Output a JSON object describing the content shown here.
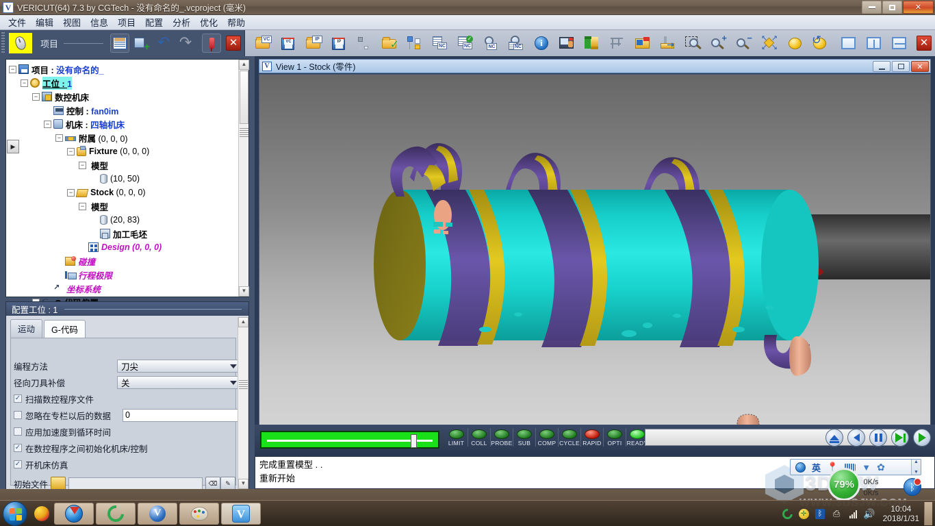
{
  "window": {
    "title": "VERICUT(64)  7.3 by CGTech - 没有命名的_.vcproject (毫米)",
    "icon": "vericut-icon",
    "buttons": {
      "minimize": "minimize-button",
      "restore": "restore-button",
      "close": "✕"
    }
  },
  "menubar": {
    "items": [
      "文件",
      "编辑",
      "视图",
      "信息",
      "项目",
      "配置",
      "分析",
      "优化",
      "帮助"
    ]
  },
  "toolbar_left": {
    "label": "项目",
    "buttons": [
      {
        "name": "mouse-config-icon",
        "glyph": "mouse"
      },
      {
        "name": "project-tree-button",
        "glyph": "project"
      },
      {
        "name": "add-component-button",
        "glyph": "add"
      },
      {
        "name": "undo-button",
        "glyph": "↶"
      },
      {
        "name": "redo-button",
        "glyph": "↷"
      },
      {
        "name": "pin-button",
        "glyph": "pin"
      },
      {
        "name": "close-panel-button",
        "glyph": "✕"
      }
    ]
  },
  "toolbar_main": {
    "buttons": [
      {
        "name": "open-project-icon",
        "label": "VC"
      },
      {
        "name": "save-project-icon",
        "label": "VC"
      },
      {
        "name": "open-inprocess-icon",
        "label": "IP"
      },
      {
        "name": "save-inprocess-icon",
        "label": "IP"
      },
      {
        "name": "tool-manager-icon",
        "label": ""
      },
      {
        "name": "open-verified-icon",
        "label": ""
      },
      {
        "name": "model-export-icon",
        "label": ""
      },
      {
        "name": "nc-program-icon",
        "label": "NC"
      },
      {
        "name": "nc-program-verified-icon",
        "label": "NC"
      },
      {
        "name": "nc-program-review-icon",
        "label": "NC"
      },
      {
        "name": "nc-review-list-icon",
        "label": "NC"
      },
      {
        "name": "info-icon",
        "label": "i"
      },
      {
        "name": "machine-control-icon",
        "label": ""
      },
      {
        "name": "autodiff-icon",
        "label": ""
      },
      {
        "name": "caliper-measure-icon",
        "label": ""
      },
      {
        "name": "notes-icon",
        "label": ""
      },
      {
        "name": "cut-stock-icon",
        "label": ""
      },
      {
        "name": "zoom-box-icon",
        "label": ""
      },
      {
        "name": "zoom-in-icon",
        "label": "+"
      },
      {
        "name": "zoom-out-icon",
        "label": "−"
      },
      {
        "name": "fit-view-icon",
        "label": ""
      },
      {
        "name": "rotate-sphere-icon",
        "label": ""
      },
      {
        "name": "reset-rotation-icon",
        "label": ""
      },
      {
        "name": "single-pane-icon",
        "label": ""
      },
      {
        "name": "two-pane-vertical-icon",
        "label": ""
      },
      {
        "name": "two-pane-horizontal-icon",
        "label": ""
      },
      {
        "name": "close-view-icon",
        "label": "✕"
      }
    ]
  },
  "tree": {
    "expander_glyph": "▶",
    "nodes": [
      {
        "indent": 0,
        "exp": "−",
        "icon": "save-icon",
        "label": "项目 : ",
        "value": "没有命名的_",
        "style": "blue"
      },
      {
        "indent": 1,
        "exp": "−",
        "icon": "gear-icon",
        "label": "工位 : ",
        "value": "1",
        "style": "selected"
      },
      {
        "indent": 2,
        "exp": "−",
        "icon": "machine-icon",
        "label": "数控机床",
        "value": "",
        "style": "bold"
      },
      {
        "indent": 3,
        "exp": "",
        "icon": "control-icon",
        "label": "控制 : ",
        "value": "fan0im",
        "style": "blue"
      },
      {
        "indent": 3,
        "exp": "−",
        "icon": "tool-icon",
        "label": "机床 : ",
        "value": "四轴机床",
        "style": "blue"
      },
      {
        "indent": 4,
        "exp": "−",
        "icon": "attach-icon",
        "label": "附属 ",
        "value": "(0, 0, 0)",
        "style": "plain"
      },
      {
        "indent": 5,
        "exp": "−",
        "icon": "fixture-icon",
        "label": "Fixture ",
        "value": "(0, 0, 0)",
        "style": "plain"
      },
      {
        "indent": 6,
        "exp": "−",
        "icon": "model-icon",
        "label": "模型",
        "value": "",
        "style": "bold"
      },
      {
        "indent": 7,
        "exp": "",
        "icon": "cylinder-icon",
        "label": "",
        "value": "(10, 50)",
        "style": "plain"
      },
      {
        "indent": 5,
        "exp": "−",
        "icon": "stock-icon",
        "label": "Stock ",
        "value": "(0, 0, 0)",
        "style": "plain"
      },
      {
        "indent": 6,
        "exp": "−",
        "icon": "model-icon",
        "label": "模型",
        "value": "",
        "style": "bold"
      },
      {
        "indent": 7,
        "exp": "",
        "icon": "cylinder-icon",
        "label": "",
        "value": "(20, 83)",
        "style": "plain"
      },
      {
        "indent": 7,
        "exp": "",
        "icon": "blank-icon",
        "label": "加工毛坯",
        "value": "",
        "style": "bold"
      },
      {
        "indent": 6,
        "exp": "",
        "icon": "design-icon",
        "label": "Design ",
        "value": "(0, 0, 0)",
        "style": "magenta"
      },
      {
        "indent": 4,
        "exp": "",
        "icon": "collision-icon",
        "label": "碰撞",
        "value": "",
        "style": "magenta"
      },
      {
        "indent": 4,
        "exp": "",
        "icon": "travel-limit-icon",
        "label": "行程极限",
        "value": "",
        "style": "magenta"
      },
      {
        "indent": 3,
        "exp": "",
        "icon": "coord-system-icon",
        "label": "坐标系统",
        "value": "",
        "style": "magenta"
      },
      {
        "indent": 2,
        "exp": "−",
        "icon": "gcode-offset-icon",
        "label": "G-代码偏置",
        "value": "",
        "style": "bold"
      }
    ]
  },
  "config": {
    "title": "配置工位 : 1",
    "tabs": [
      {
        "label": "运动",
        "active": false
      },
      {
        "label": "G-代码",
        "active": true
      }
    ],
    "fields": [
      {
        "type": "select",
        "label": "编程方法",
        "value": "刀尖"
      },
      {
        "type": "select",
        "label": "径向刀具补偿",
        "value": "关"
      },
      {
        "type": "checkbox",
        "label": "扫描数控程序文件",
        "checked": true
      },
      {
        "type": "checkbox-text",
        "label": "忽略在专栏以后的数据",
        "checked": false,
        "value": "0"
      },
      {
        "type": "checkbox",
        "label": "应用加速度到循环时间",
        "checked": false
      },
      {
        "type": "checkbox",
        "label": "在数控程序之间初始化机床/控制",
        "checked": true
      },
      {
        "type": "checkbox",
        "label": "开机床仿真",
        "checked": true
      }
    ],
    "file_row": {
      "label": "初始文件",
      "value": "",
      "browse_icon": "open-folder-icon",
      "clear_icon": "clear-field-icon",
      "edit_icon": "edit-nc-icon"
    }
  },
  "view": {
    "title": "View 1 - Stock (零件)",
    "icon": "vericut-view-icon",
    "buttons": {
      "minimize": "minimize",
      "maximize": "maximize",
      "close": "✕"
    }
  },
  "status": {
    "progress_percent": 83,
    "leds": [
      {
        "label": "LIMIT",
        "state": "green"
      },
      {
        "label": "COLL",
        "state": "green"
      },
      {
        "label": "PROBE",
        "state": "green"
      },
      {
        "label": "SUB",
        "state": "green"
      },
      {
        "label": "COMP",
        "state": "green"
      },
      {
        "label": "CYCLE",
        "state": "green"
      },
      {
        "label": "RAPID",
        "state": "red"
      },
      {
        "label": "OPTI",
        "state": "green"
      },
      {
        "label": "READY",
        "state": "bright"
      }
    ],
    "playback": [
      {
        "name": "reset-button",
        "glyph": "eject"
      },
      {
        "name": "rewind-button",
        "glyph": "rewind"
      },
      {
        "name": "pause-button",
        "glyph": "pause"
      },
      {
        "name": "step-button",
        "glyph": "step"
      },
      {
        "name": "play-button",
        "glyph": "play"
      }
    ]
  },
  "messages": {
    "lines": [
      "完成重置模型 . .",
      "重新开始"
    ]
  },
  "taskbar": {
    "apps": [
      {
        "name": "taskbar-item-idm",
        "glyph": "idm"
      },
      {
        "name": "taskbar-item-browser",
        "glyph": "e"
      },
      {
        "name": "taskbar-item-vericut",
        "glyph": "V"
      },
      {
        "name": "taskbar-item-paint",
        "glyph": "paint"
      },
      {
        "name": "taskbar-item-vericut-active",
        "glyph": "V"
      }
    ],
    "tray": {
      "icons": [
        "browser-icon",
        "security-icon",
        "bluetooth-icon",
        "usb-icon",
        "signal-icon",
        "volume-icon"
      ],
      "time": "10:04",
      "date": "2018/1/31"
    },
    "ime": {
      "mode": "英",
      "icons": [
        "user-icon",
        "pin-icon",
        "keyboard-icon",
        "toolbox-icon",
        "settings-icon"
      ]
    },
    "netspeed": {
      "up": "0K/s",
      "down": "0K/s"
    },
    "widget_percent": "79%"
  },
  "watermark": {
    "brand": "3DSJW",
    "url": "WWW.3DSJW.COM"
  },
  "colors": {
    "stock_cyan": "#18d6d0",
    "thread_purple": "#6b4f9e",
    "thread_gold": "#d4b820",
    "tool_salmon": "#eaa383",
    "selection_cyan": "#7ff2ec",
    "tree_blue": "#1a3fd0",
    "tree_magenta": "#c010c0",
    "progress_green": "#19e019",
    "led_red": "#c01a08"
  }
}
